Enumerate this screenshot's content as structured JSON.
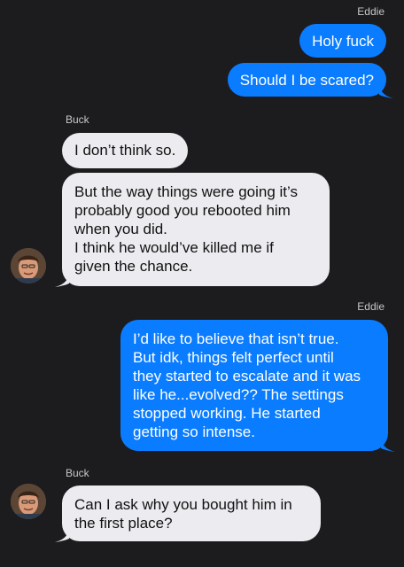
{
  "thread": {
    "sender_right": "Eddie",
    "sender_left": "Buck",
    "messages": [
      {
        "from": "Eddie",
        "text": "Holy fuck"
      },
      {
        "from": "Eddie",
        "text": "Should I be scared?"
      },
      {
        "from": "Buck",
        "text": "I don’t think so."
      },
      {
        "from": "Buck",
        "text": "But the way things were going it’s\nprobably good you rebooted him\nwhen you did.\nI think he would’ve killed me if\ngiven the chance."
      },
      {
        "from": "Eddie",
        "text": "I’d like to believe that isn’t true.\nBut idk, things felt perfect until\nthey started to escalate and it was\nlike he...evolved?? The settings\nstopped working. He started\ngetting so intense."
      },
      {
        "from": "Buck",
        "text": "Can I ask why you bought him in\nthe first place?"
      }
    ]
  },
  "colors": {
    "background": "#1c1c1e",
    "outgoing": "#0a7cff",
    "incoming": "#ececf0"
  },
  "icons": {
    "avatar": "contact-photo"
  }
}
